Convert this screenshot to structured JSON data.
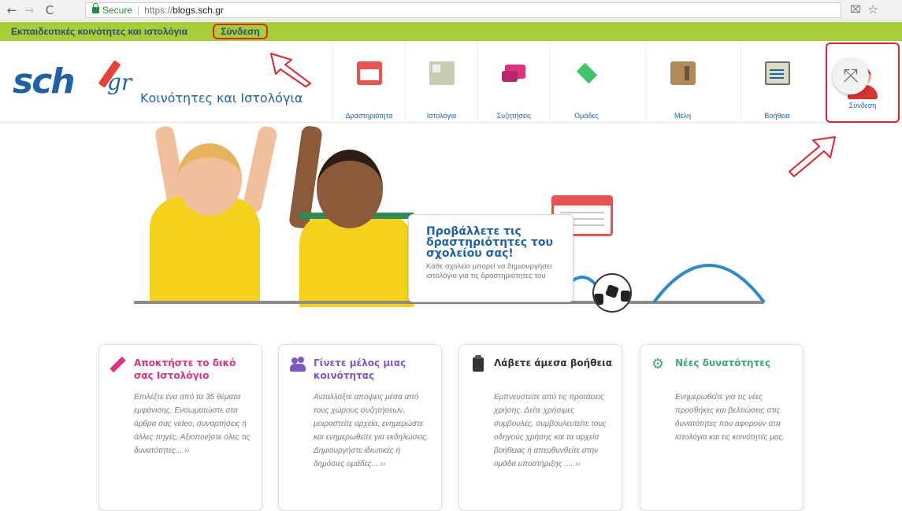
{
  "browser": {
    "nav_back": "←",
    "nav_forward": "→",
    "nav_reload": "C",
    "secure_label": "Secure",
    "url_scheme": "https://",
    "url_host": "blogs.sch.gr",
    "translate_icon": "translate-icon",
    "star_icon": "star-icon"
  },
  "community_bar": {
    "title": "Εκπαιδευτικές κοινότητες και ιστολόγια",
    "login_link": "Σύνδεση",
    "color": "#a6ce39"
  },
  "header": {
    "logo_text": "sch",
    "logo_suffix": "gr",
    "site_title": "Κοινότητες και Ιστολόγια",
    "nav": [
      {
        "label": "Δραστηριότητα",
        "icon": "activity-icon"
      },
      {
        "label": "Ιστολόγια",
        "icon": "blog-icon"
      },
      {
        "label": "Συζητήσεις",
        "icon": "discussion-icon"
      },
      {
        "label": "Ομάδες",
        "icon": "groups-icon"
      },
      {
        "label": "Μέλη",
        "icon": "members-icon"
      },
      {
        "label": "Βοήθεια",
        "icon": "help-icon"
      },
      {
        "label": "Σύνδεση",
        "icon": "user-icon"
      }
    ],
    "expand_icon": "expand-icon",
    "accent": "#1e63a8"
  },
  "hero": {
    "promo_title": "Προβάλλετε τις δραστηριότητες του σχολείου σας!",
    "promo_text": "Κάθε σχολείο μπορεί να δημιουργήσει ιστολόγιο για τις δραστηριότητες του"
  },
  "cards": [
    {
      "icon": "pencil-icon",
      "title": "Αποκτήστε το δικό σας Ιστολόγιο",
      "color": "#e0327a",
      "text": "Επιλέξτε ένα από τα 35 θέματα εμφάνισης. Ενσωματώστε στα άρθρα σας video, συναρτήσεις ή άλλες πηγές. Αξιοποιήστε όλες τις δυνατότητες... ››"
    },
    {
      "icon": "people-icon",
      "title": "Γίνετε μέλος μιας κοινότητας",
      "color": "#7e57c2",
      "text": "Ανταλλάξτε απόψεις μέσα από τους χώρους συζητήσεων, μοιραστείτε αρχεία, ενημερώστε και ενημερωθείτε για εκδηλώσεις. Δημιουργήστε ιδιωτικές ή δημόσιες ομάδες... ››"
    },
    {
      "icon": "clipboard-icon",
      "title": "Λάβετε άμεσα βοήθεια",
      "color": "#333333",
      "text": "Εμπνευστείτε από τις προτάσεις χρήσης. Δείτε χρήσιμες συμβουλές, συμβουλευτείτε τους οδηγούς χρήσης και τα αρχεία βοήθειας ή απευθυνθείτε στην ομάδα υποστήριξης .... ››"
    },
    {
      "icon": "gears-icon",
      "title": "Νέες δυνατότητες",
      "color": "#3aa675",
      "text": "Ενημερωθείτε για τις νέες προσθήκες και βελτιώσεις στις δυνατότητες που αφορούν στα ιστολόγια και τις κοινότητές μας."
    }
  ]
}
